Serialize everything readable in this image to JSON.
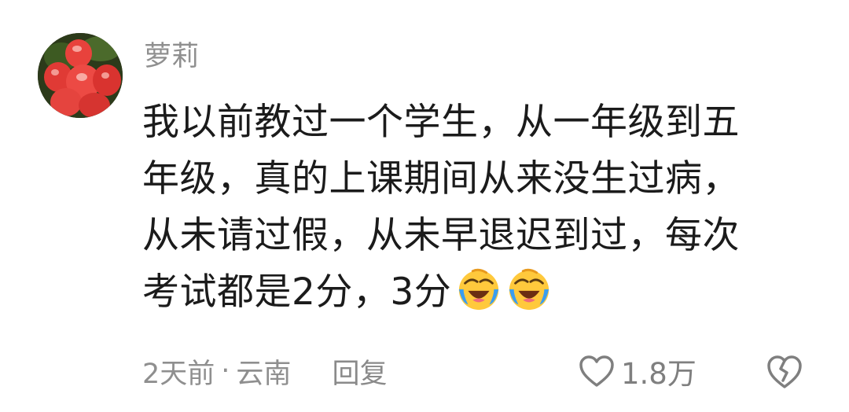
{
  "comment": {
    "username": "萝莉",
    "lines": [
      "我以前教过一个学生，从一年级到五",
      "年级，真的上课期间从来没生过病，",
      "从未请过假，从未早退迟到过，每次",
      "考试都是2分，3分"
    ],
    "emojis": [
      "laughing-crying-emoji",
      "laughing-crying-emoji"
    ],
    "meta": {
      "time": "2天前",
      "separator": "·",
      "location": "云南",
      "reply_label": "回复"
    },
    "likes": "1.8万",
    "icons": {
      "like": "heart-outline-icon",
      "dislike": "broken-heart-icon"
    },
    "colors": {
      "text": "#1b1b1b",
      "secondary": "#8f8f8f",
      "emoji_yellow": "#ffc93c",
      "emoji_blue": "#3a9df0"
    }
  }
}
